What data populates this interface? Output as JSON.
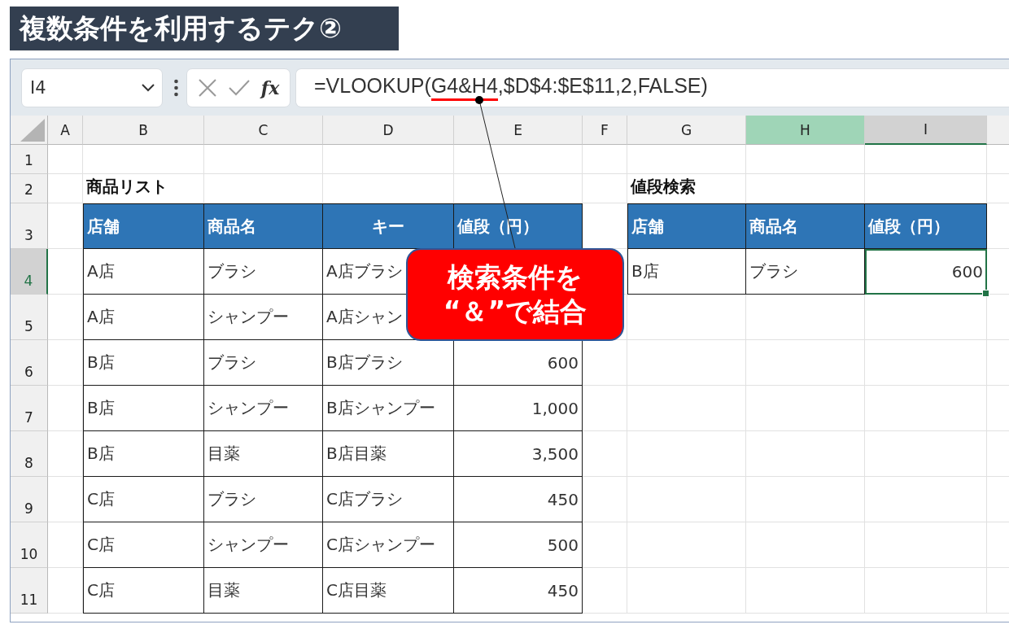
{
  "title": "複数条件を利用するテク②",
  "name_box": {
    "value": "I4"
  },
  "function_label": "fx",
  "formula_parts": [
    {
      "text": "=VLOOKUP(",
      "underlined": false
    },
    {
      "text": "G4&H4",
      "underlined": true
    },
    {
      "text": ",$D$4:$E$11,2,FALSE)",
      "underlined": false
    }
  ],
  "column_headers": [
    {
      "label": "A",
      "selected": false,
      "highlighted": false
    },
    {
      "label": "B",
      "selected": false,
      "highlighted": false
    },
    {
      "label": "C",
      "selected": false,
      "highlighted": false
    },
    {
      "label": "D",
      "selected": false,
      "highlighted": false
    },
    {
      "label": "E",
      "selected": false,
      "highlighted": false
    },
    {
      "label": "F",
      "selected": false,
      "highlighted": false
    },
    {
      "label": "G",
      "selected": false,
      "highlighted": false
    },
    {
      "label": "H",
      "selected": false,
      "highlighted": true
    },
    {
      "label": "I",
      "selected": true,
      "highlighted": false
    }
  ],
  "row_headers": [
    {
      "label": "1",
      "selected": false
    },
    {
      "label": "2",
      "selected": false
    },
    {
      "label": "3",
      "selected": false
    },
    {
      "label": "4",
      "selected": true
    },
    {
      "label": "5",
      "selected": false
    },
    {
      "label": "6",
      "selected": false
    },
    {
      "label": "7",
      "selected": false
    },
    {
      "label": "8",
      "selected": false
    },
    {
      "label": "9",
      "selected": false
    },
    {
      "label": "10",
      "selected": false
    },
    {
      "label": "11",
      "selected": false
    }
  ],
  "product_list": {
    "title": "商品リスト",
    "columns": [
      {
        "label": "店舗",
        "centered": false,
        "numeric": false
      },
      {
        "label": "商品名",
        "centered": false,
        "numeric": false
      },
      {
        "label": "キー",
        "centered": true,
        "numeric": false
      },
      {
        "label": "値段（円）",
        "centered": false,
        "numeric": true
      }
    ],
    "rows": [
      [
        "A店",
        "ブラシ",
        "A店ブラシ",
        null
      ],
      [
        "A店",
        "シャンプー",
        "A店シャン",
        null
      ],
      [
        "B店",
        "ブラシ",
        "B店ブラシ",
        "600"
      ],
      [
        "B店",
        "シャンプー",
        "B店シャンプー",
        "1,000"
      ],
      [
        "B店",
        "目薬",
        "B店目薬",
        "3,500"
      ],
      [
        "C店",
        "ブラシ",
        "C店ブラシ",
        "450"
      ],
      [
        "C店",
        "シャンプー",
        "C店シャンプー",
        "500"
      ],
      [
        "C店",
        "目薬",
        "C店目薬",
        "450"
      ]
    ]
  },
  "price_search": {
    "title": "値段検索",
    "columns": [
      {
        "label": "店舗",
        "centered": false,
        "numeric": false
      },
      {
        "label": "商品名",
        "centered": false,
        "numeric": false
      },
      {
        "label": "値段（円）",
        "centered": false,
        "numeric": true
      }
    ],
    "rows": [
      {
        "cells": [
          {
            "text": "B店",
            "selected": false
          },
          {
            "text": "ブラシ",
            "selected": false
          },
          {
            "text": "600",
            "selected": true
          }
        ]
      }
    ]
  },
  "callout": {
    "lines": [
      "検索条件を",
      "“＆”で結合"
    ]
  }
}
